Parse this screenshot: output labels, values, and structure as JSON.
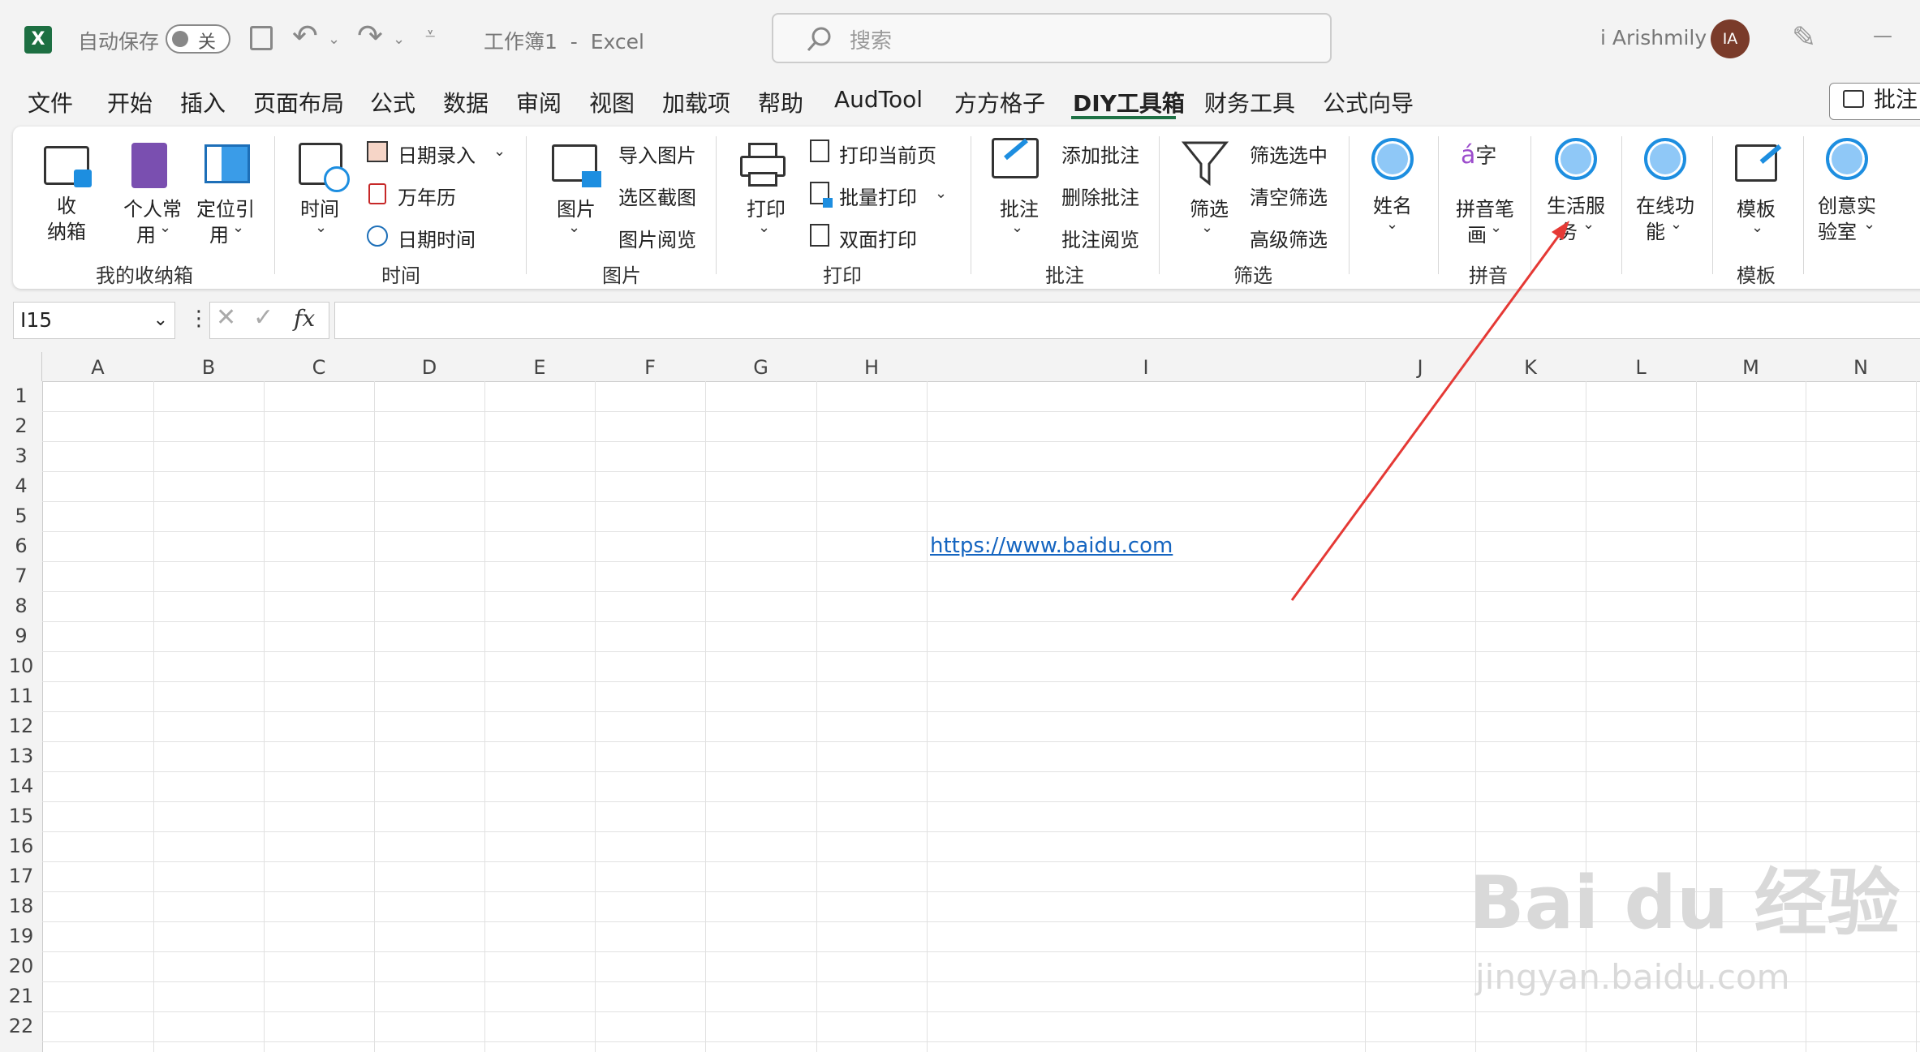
{
  "titlebar": {
    "autosave_label": "自动保存",
    "toggle_state": "关",
    "doc_title": "工作簿1  -  Excel",
    "search_placeholder": "搜索",
    "user_name": "i Arishmily",
    "avatar_initials": "IA",
    "minimize": "—"
  },
  "tabs": [
    "文件",
    "开始",
    "插入",
    "页面布局",
    "公式",
    "数据",
    "审阅",
    "视图",
    "加载项",
    "帮助",
    "AudTool",
    "方方格子",
    "DIY工具箱",
    "财务工具",
    "公式向导"
  ],
  "active_tab": "DIY工具箱",
  "comment_button": "批注",
  "ribbon": {
    "g1": {
      "btn1": "收\n纳箱",
      "btn2": "个人常",
      "btn2b": "用",
      "btn3": "定位引",
      "btn3b": "用",
      "label": "我的收纳箱"
    },
    "g2": {
      "time": "时间",
      "date_entry": "日期录入",
      "calendar": "万年历",
      "datetime": "日期时间",
      "label": "时间"
    },
    "g3": {
      "picture": "图片",
      "import": "导入图片",
      "screenshot": "选区截图",
      "browse": "图片阅览",
      "label": "图片"
    },
    "g4": {
      "print": "打印",
      "current": "打印当前页",
      "batch": "批量打印",
      "duplex": "双面打印",
      "label": "打印"
    },
    "g5": {
      "comment": "批注",
      "add": "添加批注",
      "delete": "删除批注",
      "review": "批注阅览",
      "label": "批注"
    },
    "g6": {
      "filter": "筛选",
      "filter_sel": "筛选选中",
      "clear": "清空筛选",
      "advanced": "高级筛选",
      "label": "筛选"
    },
    "g7": {
      "name": "姓名"
    },
    "g8": {
      "pinyin": "拼音笔",
      "pinyin_b": "画",
      "label": "拼音"
    },
    "g9": {
      "life": "生活服",
      "life_b": "务"
    },
    "g10": {
      "online": "在线功",
      "online_b": "能"
    },
    "g11": {
      "template": "模板",
      "label": "模板"
    },
    "g12": {
      "lab": "创意实",
      "lab_b": "验室"
    }
  },
  "formula_bar": {
    "name_box": "I15",
    "fx": "fx",
    "formula": ""
  },
  "columns": [
    "A",
    "B",
    "C",
    "D",
    "E",
    "F",
    "G",
    "H",
    "I",
    "J",
    "K",
    "L",
    "M",
    "N"
  ],
  "rows": [
    "1",
    "2",
    "3",
    "4",
    "5",
    "6",
    "7",
    "8",
    "9",
    "10",
    "11",
    "12",
    "13",
    "14",
    "15",
    "16",
    "17",
    "18",
    "19",
    "20",
    "21",
    "22"
  ],
  "cells": {
    "I6": "https://www.baidu.com"
  },
  "watermark": {
    "brand": "Bai  du 经验",
    "url": "jingyan.baidu.com"
  },
  "annotation_color": "#e53935"
}
